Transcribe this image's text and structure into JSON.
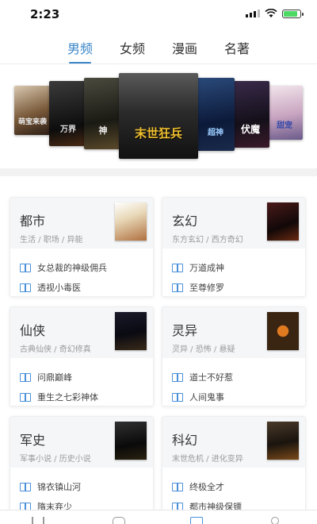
{
  "status_bar": {
    "time": "2:23",
    "battery_level": 0.85
  },
  "tabs": [
    {
      "label": "男频",
      "active": true
    },
    {
      "label": "女频",
      "active": false
    },
    {
      "label": "漫画",
      "active": false
    },
    {
      "label": "名著",
      "active": false
    }
  ],
  "banner": {
    "covers": [
      {
        "title": "萌宝来袭"
      },
      {
        "title": "万界"
      },
      {
        "title": "神"
      },
      {
        "title": "末世狂兵"
      },
      {
        "title": "超神"
      },
      {
        "title": "伏魔"
      },
      {
        "title": "甜宠"
      }
    ]
  },
  "categories": [
    {
      "name": "都市",
      "tags": "生活 / 职场 / 异能",
      "books": [
        "女总裁的神级佣兵",
        "透视小毒医"
      ]
    },
    {
      "name": "玄幻",
      "tags": "东方玄幻 / 西方奇幻",
      "books": [
        "万道成神",
        "至尊修罗"
      ]
    },
    {
      "name": "仙侠",
      "tags": "古典仙侠 / 奇幻修真",
      "books": [
        "问鼎巅峰",
        "重生之七彩神体"
      ]
    },
    {
      "name": "灵异",
      "tags": "灵异 / 恐怖 / 悬疑",
      "books": [
        "道士不好惹",
        "人间鬼事"
      ]
    },
    {
      "name": "军史",
      "tags": "军事小说 / 历史小说",
      "books": [
        "锦衣镇山河",
        "隋末弃少"
      ]
    },
    {
      "name": "科幻",
      "tags": "末世危机 / 进化变异",
      "books": [
        "终极全才",
        "都市神级保镖"
      ]
    }
  ],
  "icons": {
    "book": "open-book-icon",
    "nav": [
      "bookshelf-icon",
      "chat-icon",
      "category-icon",
      "user-icon"
    ]
  },
  "colors": {
    "accent": "#3a86c8",
    "tag_text": "#9a9a9a"
  }
}
